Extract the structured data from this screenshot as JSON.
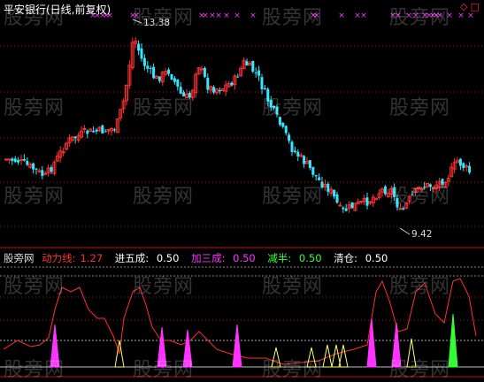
{
  "header": {
    "title": "平安银行(日线,前复权)",
    "corner_icons": [
      "diamond-outline-icon",
      "square-outline-icon"
    ]
  },
  "price_chart": {
    "high_label": "13.38",
    "low_label": "9.42"
  },
  "indicator": {
    "name": "股旁网",
    "items": [
      {
        "label": "动力线:",
        "value": "1.27",
        "color": "#ff3030"
      },
      {
        "label": "进五成:",
        "value": "0.50",
        "color": "#ffffff"
      },
      {
        "label": "加三成:",
        "value": "0.50",
        "color": "#ff33ff"
      },
      {
        "label": "减半:",
        "value": "0.50",
        "color": "#33ff33"
      },
      {
        "label": "清仓:",
        "value": "0.50",
        "color": "#ffffff"
      }
    ]
  },
  "watermark": "股旁网",
  "colors": {
    "up": "#ff3030",
    "down": "#30e8ff",
    "grid": "#b01010",
    "marker": "#ff33ff",
    "yellow": "#ffff66"
  }
}
